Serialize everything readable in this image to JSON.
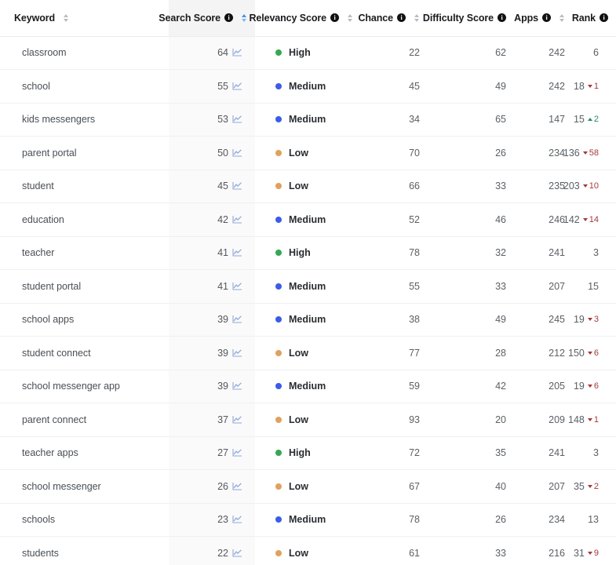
{
  "table": {
    "columns": [
      {
        "key": "keyword",
        "label": "Keyword",
        "info": false,
        "sortable": true,
        "sorted": false,
        "align": "left"
      },
      {
        "key": "search",
        "label": "Search Score",
        "info": true,
        "sortable": true,
        "sorted": true,
        "align": "right"
      },
      {
        "key": "relevancy",
        "label": "Relevancy Score",
        "info": true,
        "sortable": true,
        "sorted": false,
        "align": "left"
      },
      {
        "key": "chance",
        "label": "Chance",
        "info": true,
        "sortable": true,
        "sorted": false,
        "align": "right"
      },
      {
        "key": "difficulty",
        "label": "Difficulty Score",
        "info": true,
        "sortable": false,
        "sorted": false,
        "align": "right"
      },
      {
        "key": "apps",
        "label": "Apps",
        "info": true,
        "sortable": true,
        "sorted": false,
        "align": "right"
      },
      {
        "key": "rank",
        "label": "Rank",
        "info": true,
        "sortable": false,
        "sorted": false,
        "align": "right"
      }
    ],
    "rows": [
      {
        "keyword": "classroom",
        "search": 64,
        "relevancy": "High",
        "relevancy_level": "high",
        "chance": 22,
        "difficulty": 62,
        "apps": 242,
        "rank": 6,
        "delta": null,
        "delta_dir": null
      },
      {
        "keyword": "school",
        "search": 55,
        "relevancy": "Medium",
        "relevancy_level": "medium",
        "chance": 45,
        "difficulty": 49,
        "apps": 242,
        "rank": 18,
        "delta": 1,
        "delta_dir": "down"
      },
      {
        "keyword": "kids messengers",
        "search": 53,
        "relevancy": "Medium",
        "relevancy_level": "medium",
        "chance": 34,
        "difficulty": 65,
        "apps": 147,
        "rank": 15,
        "delta": 2,
        "delta_dir": "up"
      },
      {
        "keyword": "parent portal",
        "search": 50,
        "relevancy": "Low",
        "relevancy_level": "low",
        "chance": 70,
        "difficulty": 26,
        "apps": 234,
        "rank": 136,
        "delta": 58,
        "delta_dir": "down"
      },
      {
        "keyword": "student",
        "search": 45,
        "relevancy": "Low",
        "relevancy_level": "low",
        "chance": 66,
        "difficulty": 33,
        "apps": 235,
        "rank": 203,
        "delta": 10,
        "delta_dir": "down"
      },
      {
        "keyword": "education",
        "search": 42,
        "relevancy": "Medium",
        "relevancy_level": "medium",
        "chance": 52,
        "difficulty": 46,
        "apps": 246,
        "rank": 142,
        "delta": 14,
        "delta_dir": "down"
      },
      {
        "keyword": "teacher",
        "search": 41,
        "relevancy": "High",
        "relevancy_level": "high",
        "chance": 78,
        "difficulty": 32,
        "apps": 241,
        "rank": 3,
        "delta": null,
        "delta_dir": null
      },
      {
        "keyword": "student portal",
        "search": 41,
        "relevancy": "Medium",
        "relevancy_level": "medium",
        "chance": 55,
        "difficulty": 33,
        "apps": 207,
        "rank": 15,
        "delta": null,
        "delta_dir": null
      },
      {
        "keyword": "school apps",
        "search": 39,
        "relevancy": "Medium",
        "relevancy_level": "medium",
        "chance": 38,
        "difficulty": 49,
        "apps": 245,
        "rank": 19,
        "delta": 3,
        "delta_dir": "down"
      },
      {
        "keyword": "student connect",
        "search": 39,
        "relevancy": "Low",
        "relevancy_level": "low",
        "chance": 77,
        "difficulty": 28,
        "apps": 212,
        "rank": 150,
        "delta": 6,
        "delta_dir": "down"
      },
      {
        "keyword": "school messenger app",
        "search": 39,
        "relevancy": "Medium",
        "relevancy_level": "medium",
        "chance": 59,
        "difficulty": 42,
        "apps": 205,
        "rank": 19,
        "delta": 6,
        "delta_dir": "down"
      },
      {
        "keyword": "parent connect",
        "search": 37,
        "relevancy": "Low",
        "relevancy_level": "low",
        "chance": 93,
        "difficulty": 20,
        "apps": 209,
        "rank": 148,
        "delta": 1,
        "delta_dir": "down"
      },
      {
        "keyword": "teacher apps",
        "search": 27,
        "relevancy": "High",
        "relevancy_level": "high",
        "chance": 72,
        "difficulty": 35,
        "apps": 241,
        "rank": 3,
        "delta": null,
        "delta_dir": null
      },
      {
        "keyword": "school messenger",
        "search": 26,
        "relevancy": "Low",
        "relevancy_level": "low",
        "chance": 67,
        "difficulty": 40,
        "apps": 207,
        "rank": 35,
        "delta": 2,
        "delta_dir": "down"
      },
      {
        "keyword": "schools",
        "search": 23,
        "relevancy": "Medium",
        "relevancy_level": "medium",
        "chance": 78,
        "difficulty": 26,
        "apps": 234,
        "rank": 13,
        "delta": null,
        "delta_dir": null
      },
      {
        "keyword": "students",
        "search": 22,
        "relevancy": "Low",
        "relevancy_level": "low",
        "chance": 61,
        "difficulty": 33,
        "apps": 216,
        "rank": 31,
        "delta": 9,
        "delta_dir": "down"
      }
    ]
  },
  "icons": {
    "info": "i",
    "sparkline": "sparkline-icon",
    "sort": "sort-arrows-icon"
  },
  "colors": {
    "relevancy_high": "#34a853",
    "relevancy_medium": "#3b5ce8",
    "relevancy_low": "#e0a15e",
    "delta_down": "#a33a3a",
    "delta_up": "#2a8a6a",
    "sort_active": "#4a90e2",
    "sparkline": "#8fa9d8",
    "sorted_column_bg": "#fafafa"
  }
}
